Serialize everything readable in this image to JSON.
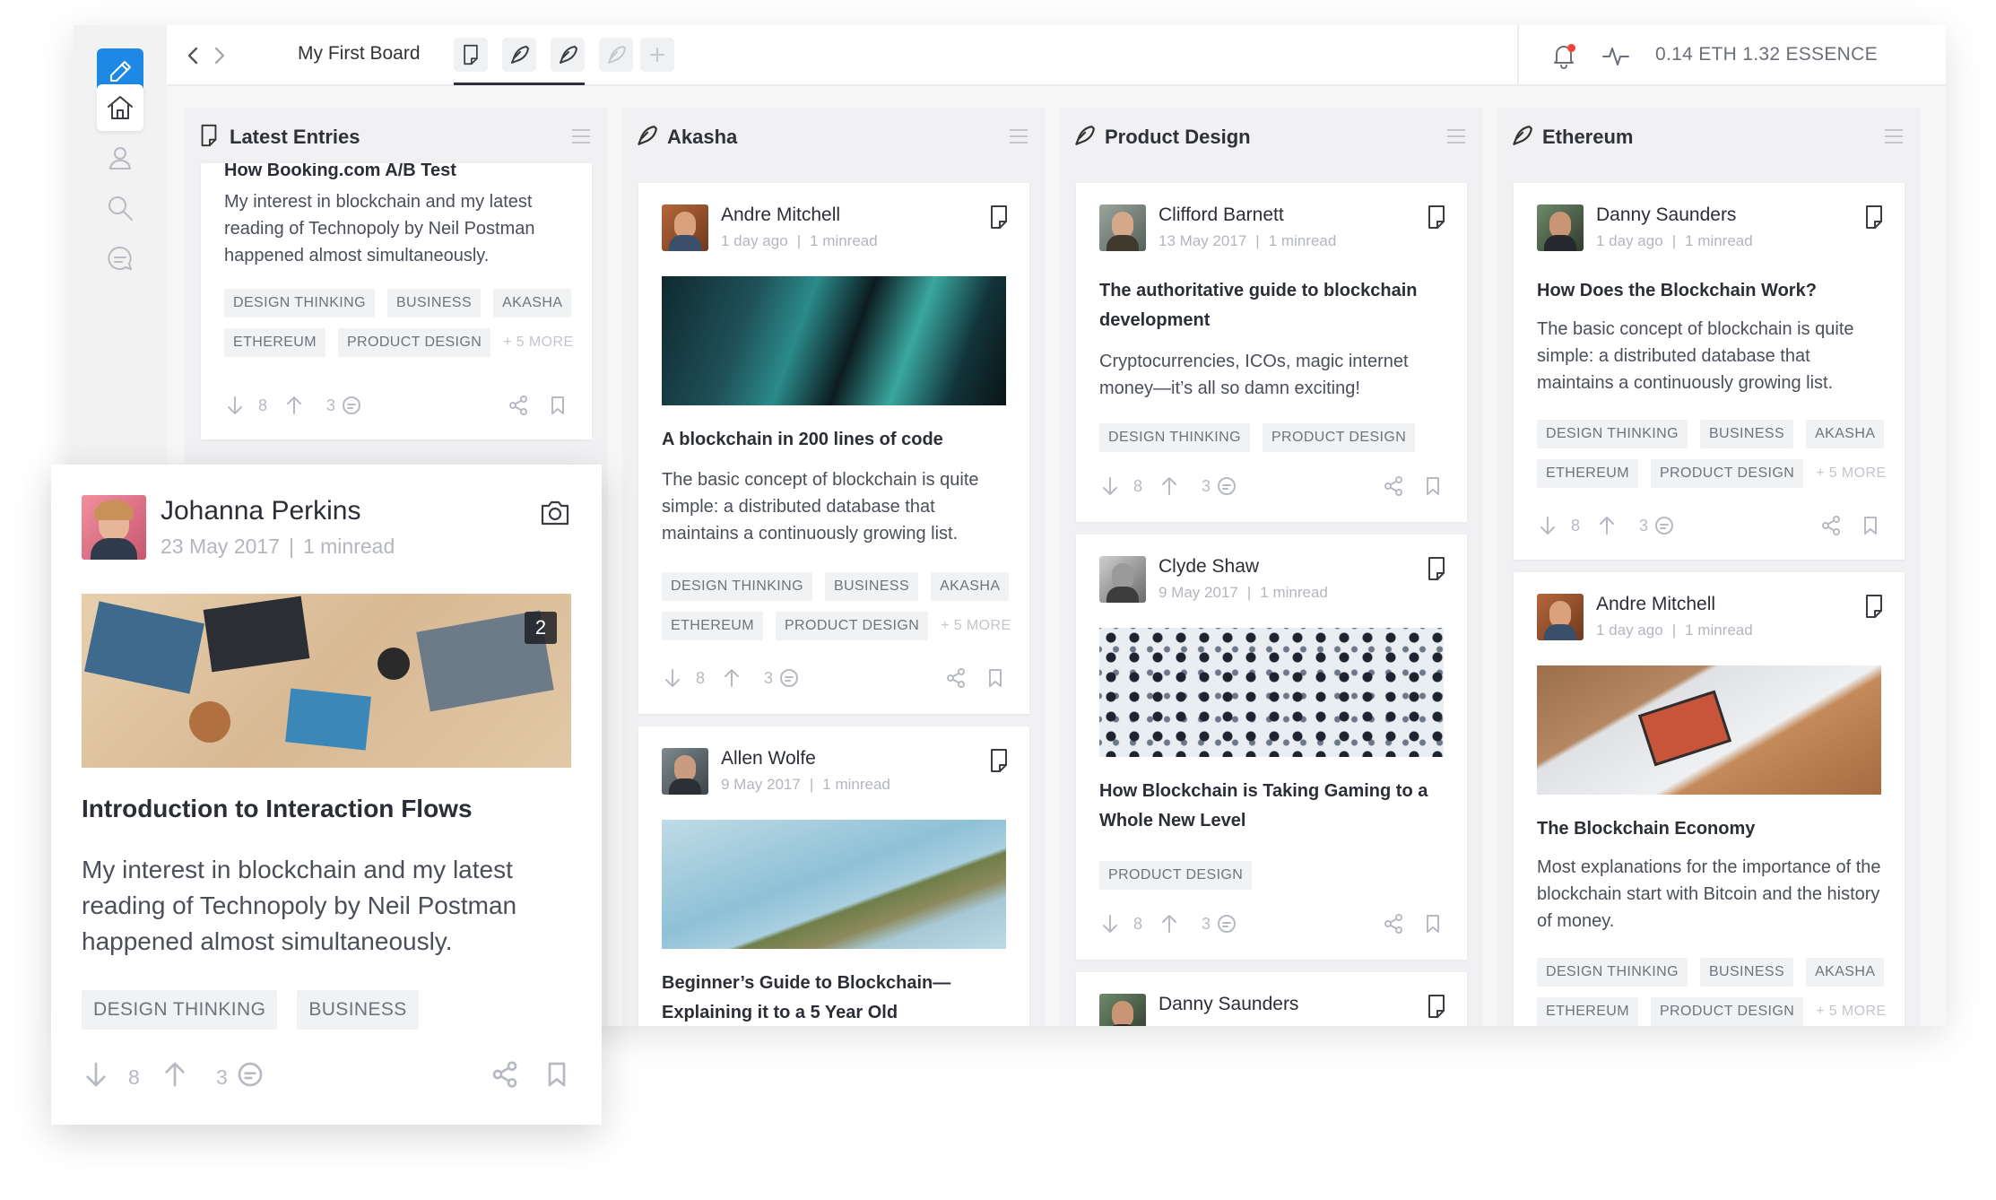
{
  "topbar": {
    "board_title": "My First Board",
    "balance": "0.14 ETH   1.32 ESSENCE"
  },
  "sidebar": {
    "items": [
      "edit",
      "home",
      "profile",
      "search",
      "chat"
    ]
  },
  "icons": {
    "edit": "pencil-icon",
    "home": "home-icon",
    "profile": "user-icon",
    "search": "search-icon",
    "chat": "chat-icon",
    "notification": "bell-icon",
    "activity": "pulse-icon",
    "entry_type_text": "document-icon",
    "entry_type_image": "camera-icon"
  },
  "colors": {
    "accent": "#1e88e5",
    "notification_dot": "#f44336"
  },
  "columns": [
    {
      "title": "Latest Entries",
      "cards": [
        {
          "title": "How Booking.com A/B Test",
          "body": "My interest in blockchain and my latest reading of Technopoly by Neil Postman happened almost simultaneously.",
          "tags": [
            "DESIGN THINKING",
            "BUSINESS",
            "AKASHA",
            "ETHEREUM",
            "PRODUCT DESIGN"
          ],
          "more": "+ 5 MORE",
          "downvotes": "8",
          "comments": "3"
        }
      ]
    },
    {
      "title": "Akasha",
      "cards": [
        {
          "author": "Andre Mitchell",
          "date": "1 day ago",
          "read": "1 minread",
          "title": "A blockchain in 200 lines of code",
          "body": "The basic concept of blockchain is quite simple: a distributed database that maintains a continuously growing list.",
          "tags": [
            "DESIGN THINKING",
            "BUSINESS",
            "AKASHA",
            "ETHEREUM",
            "PRODUCT DESIGN"
          ],
          "more": "+ 5 MORE",
          "downvotes": "8",
          "comments": "3"
        },
        {
          "author": "Allen Wolfe",
          "date": "9 May 2017",
          "read": "1 minread",
          "title": "Beginner’s Guide to Blockchain—Explaining it to a 5 Year Old"
        }
      ]
    },
    {
      "title": "Product Design",
      "cards": [
        {
          "author": "Clifford Barnett",
          "date": "13 May 2017",
          "read": "1 minread",
          "title": "The authoritative guide to blockchain development",
          "body": "Cryptocurrencies, ICOs, magic internet money—it’s all so damn exciting!",
          "tags": [
            "DESIGN THINKING",
            "PRODUCT DESIGN"
          ],
          "downvotes": "8",
          "comments": "3"
        },
        {
          "author": "Clyde Shaw",
          "date": "9 May 2017",
          "read": "1 minread",
          "title": "How Blockchain is Taking Gaming to a Whole New Level",
          "tags": [
            "PRODUCT DESIGN"
          ],
          "downvotes": "8",
          "comments": "3"
        },
        {
          "author": "Danny Saunders"
        }
      ]
    },
    {
      "title": "Ethereum",
      "cards": [
        {
          "author": "Danny Saunders",
          "date": "1 day ago",
          "read": "1 minread",
          "title": "How Does the Blockchain Work?",
          "body": "The basic concept of blockchain is quite simple: a distributed database that maintains a continuously growing list.",
          "tags": [
            "DESIGN THINKING",
            "BUSINESS",
            "AKASHA",
            "ETHEREUM",
            "PRODUCT DESIGN"
          ],
          "more": "+ 5 MORE",
          "downvotes": "8",
          "comments": "3"
        },
        {
          "author": "Andre Mitchell",
          "date": "1 day ago",
          "read": "1 minread",
          "title": "The Blockchain Economy",
          "body": "Most explanations for the importance of the blockchain start with Bitcoin and the history of money.",
          "tags": [
            "DESIGN THINKING",
            "BUSINESS",
            "AKASHA",
            "ETHEREUM",
            "PRODUCT DESIGN"
          ],
          "more": "+ 5 MORE"
        }
      ]
    }
  ],
  "floating_card": {
    "author": "Johanna Perkins",
    "date": "23 May 2017",
    "read": "1 minread",
    "image_count": "2",
    "title": "Introduction to Interaction Flows",
    "body": "My interest in blockchain and my latest reading of Technopoly by Neil Postman happened almost simultaneously.",
    "tags": [
      "DESIGN THINKING",
      "BUSINESS"
    ],
    "downvotes": "8",
    "comments": "3"
  }
}
